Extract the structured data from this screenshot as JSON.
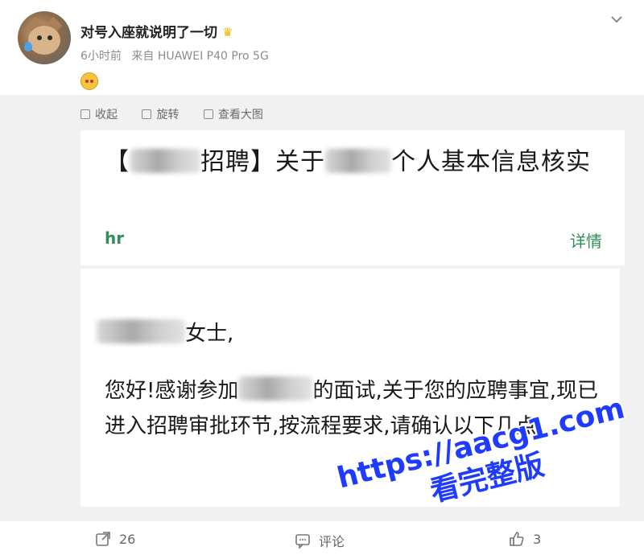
{
  "post": {
    "username": "对号入座就说明了一切",
    "time": "6小时前",
    "source": "来自 HUAWEI P40 Pro 5G"
  },
  "image_toolbar": {
    "collapse": "收起",
    "rotate": "旋转",
    "view_large": "查看大图"
  },
  "email": {
    "title_part1": "【",
    "title_part2": "招聘】关于",
    "title_part3": "个人基本信息核实",
    "sender": "hr",
    "detail": "详情",
    "greeting_suffix": "女士,",
    "body_part1": "您好!感谢参加",
    "body_part2": "的面试,关于您的应聘事宜,现已进入招聘审批环节,按流程要求,请确认以下几点:"
  },
  "watermark": {
    "line1": "https://aacg1.com",
    "line2": "看完整版"
  },
  "actions": {
    "share_count": "26",
    "comment_label": "评论",
    "like_count": "3"
  }
}
